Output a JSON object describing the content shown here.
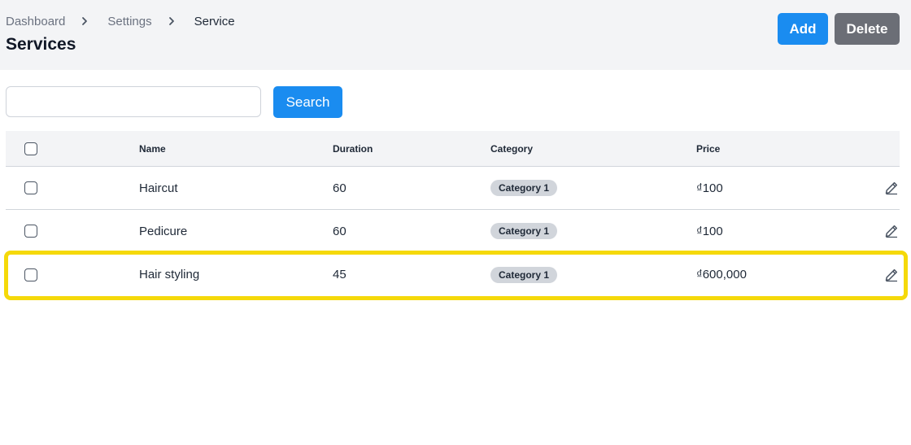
{
  "breadcrumb": {
    "items": [
      "Dashboard",
      "Settings",
      "Service"
    ]
  },
  "page": {
    "title": "Services"
  },
  "actions": {
    "add_label": "Add",
    "delete_label": "Delete"
  },
  "search": {
    "value": "",
    "placeholder": "",
    "button_label": "Search"
  },
  "table": {
    "columns": [
      "Name",
      "Duration",
      "Category",
      "Price"
    ],
    "rows": [
      {
        "name": "Haircut",
        "duration": "60",
        "category": "Category 1",
        "price": "₫100"
      },
      {
        "name": "Pedicure",
        "duration": "60",
        "category": "Category 1",
        "price": "₫100"
      },
      {
        "name": "Hair styling",
        "duration": "45",
        "category": "Category 1",
        "price": "₫600,000"
      }
    ]
  },
  "colors": {
    "primary": "#1a8cf0",
    "secondary": "#6b6e76",
    "highlight": "#f5d90a",
    "header_bg": "#f3f4f6"
  },
  "icons": {
    "separator": "chevron-right-icon",
    "row_action": "pencil-icon"
  }
}
